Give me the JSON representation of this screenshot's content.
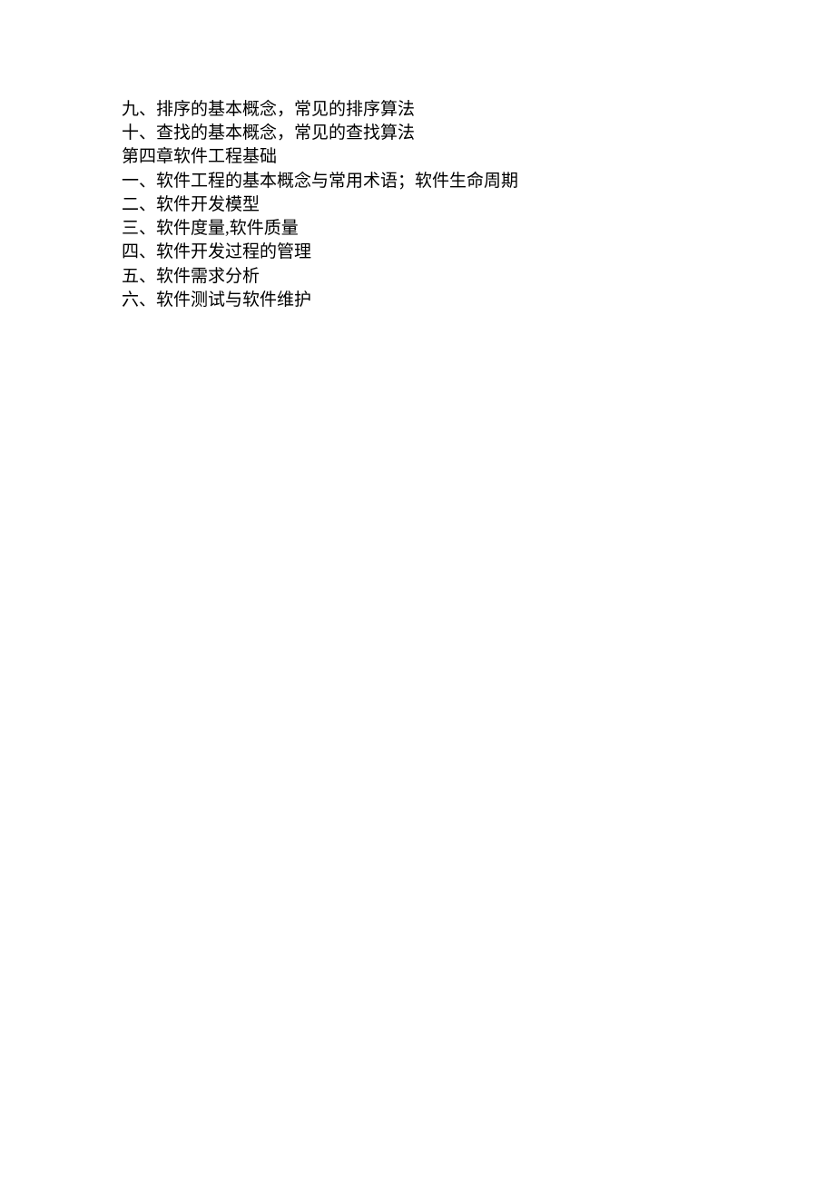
{
  "lines": [
    "九、排序的基本概念，常见的排序算法",
    "十、查找的基本概念，常见的查找算法",
    "第四章软件工程基础",
    "一、软件工程的基本概念与常用术语；软件生命周期",
    "二、软件开发模型",
    "三、软件度量,软件质量",
    "四、软件开发过程的管理",
    "五、软件需求分析",
    "六、软件测试与软件维护"
  ]
}
